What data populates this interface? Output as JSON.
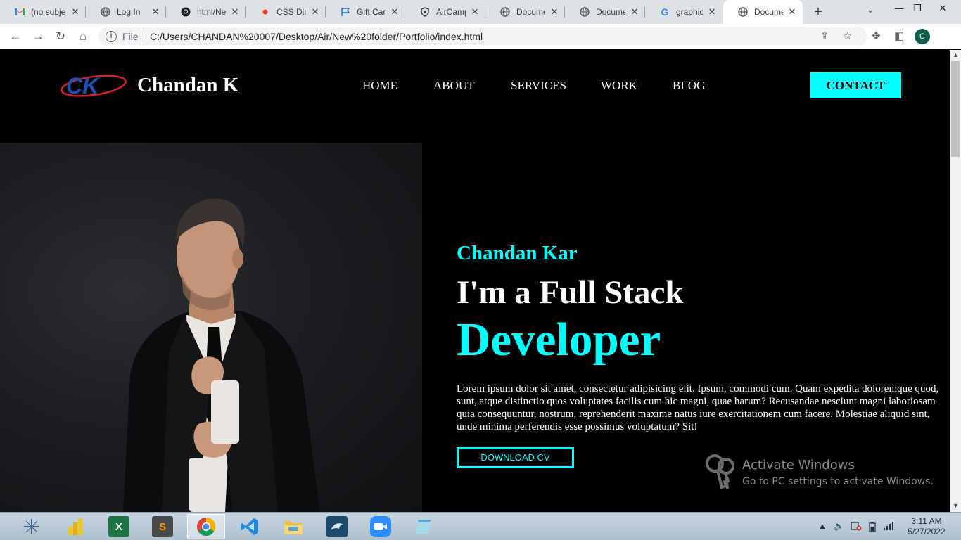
{
  "browser": {
    "tabs": [
      {
        "title": "(no subje",
        "icon": "gmail-icon"
      },
      {
        "title": "Log In",
        "icon": "globe-icon"
      },
      {
        "title": "html/Ne",
        "icon": "github-icon"
      },
      {
        "title": "CSS Dine",
        "icon": "record-icon"
      },
      {
        "title": "Gift Card",
        "icon": "flag-icon"
      },
      {
        "title": "AirCamp",
        "icon": "shield-icon"
      },
      {
        "title": "Documen",
        "icon": "globe-icon"
      },
      {
        "title": "Documen",
        "icon": "globe-icon"
      },
      {
        "title": "graphic c",
        "icon": "google-icon"
      },
      {
        "title": "Documen",
        "icon": "globe-icon",
        "active": true
      }
    ],
    "new_tab": "+",
    "file_label": "File",
    "url": "C:/Users/CHANDAN%20007/Desktop/Air/New%20folder/Portfolio/index.html",
    "profile_initial": "C"
  },
  "site": {
    "logo_text": "CK",
    "brand": "Chandan K",
    "nav": [
      "HOME",
      "ABOUT",
      "SERVICES",
      "WORK",
      "BLOG"
    ],
    "contact": "CONTACT",
    "hero": {
      "subtitle": "Chandan Kar",
      "title": "I'm a Full Stack",
      "role": "Developer",
      "description": "Lorem ipsum dolor sit amet, consectetur adipisicing elit. Ipsum, commodi cum. Quam expedita doloremque quod, sunt, atque distinctio quos voluptates facilis cum hic magni, quae harum? Recusandae nesciunt magni laboriosam quia consequuntur, nostrum, reprehenderit maxime natus iure exercitationem cum facere. Molestiae aliquid sint, unde minima perferendis esse possimus voluptatum? Sit!",
      "cta": "DOWNLOAD CV"
    },
    "colors": {
      "accent": "#00ffff",
      "background": "#000000",
      "text": "#ffffff"
    }
  },
  "watermark": {
    "line1": "Activate Windows",
    "line2": "Go to PC settings to activate Windows."
  },
  "taskbar": {
    "apps": [
      "tableau-icon",
      "power-bi-icon",
      "excel-icon",
      "sublime-text-icon",
      "chrome-icon",
      "vscode-icon",
      "file-explorer-icon",
      "mysql-workbench-icon",
      "zoom-icon",
      "notepad-icon"
    ],
    "time": "3:11 AM",
    "date": "5/27/2022"
  }
}
